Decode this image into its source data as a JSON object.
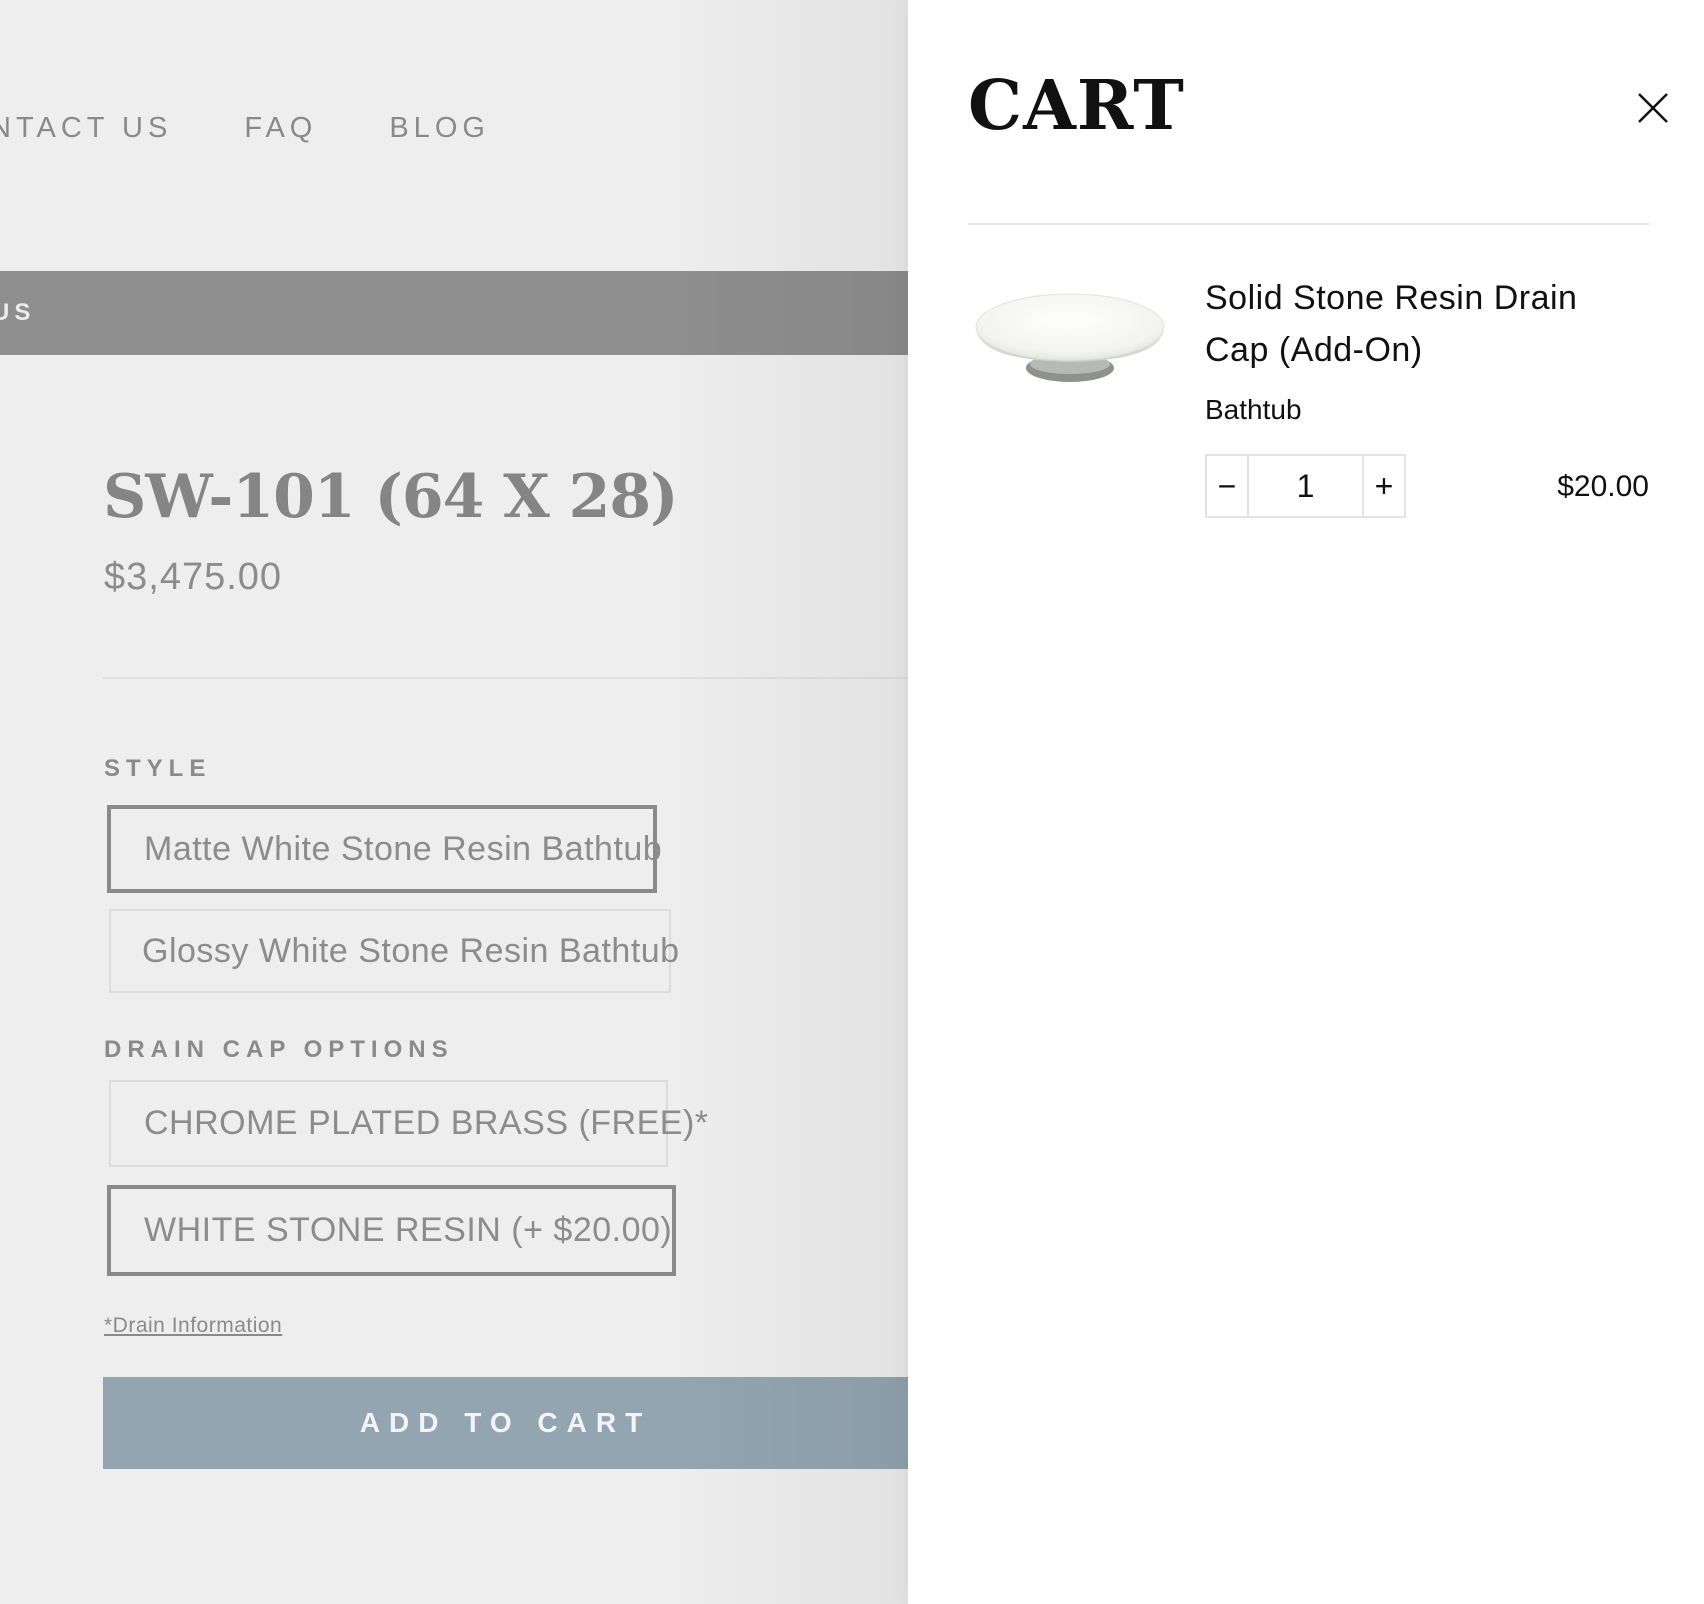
{
  "nav": {
    "items": [
      "NTACT US",
      "FAQ",
      "BLOG"
    ]
  },
  "announcement": {
    "text": "US"
  },
  "product": {
    "title": "SW-101 (64 X 28)",
    "price": "$3,475.00",
    "style_label": "STYLE",
    "style_options": [
      {
        "label": "Matte White Stone Resin Bathtub",
        "selected": true
      },
      {
        "label": "Glossy White Stone Resin Bathtub",
        "selected": false
      }
    ],
    "drain_label": "DRAIN CAP OPTIONS",
    "drain_options": [
      {
        "label": "CHROME PLATED BRASS (FREE)*",
        "selected": false
      },
      {
        "label": "WHITE STONE RESIN (+ $20.00)",
        "selected": true
      }
    ],
    "drain_info_link": "*Drain Information",
    "add_to_cart_label": "ADD TO CART"
  },
  "cart": {
    "title": "CART",
    "close_icon": "close-icon",
    "items": [
      {
        "name": "Solid Stone Resin Drain Cap (Add-On)",
        "variant": "Bathtub",
        "quantity": "1",
        "minus_label": "−",
        "plus_label": "+",
        "price": "$20.00"
      }
    ]
  },
  "colors": {
    "add_to_cart_bg": "#93a5b1",
    "announce_bg": "#8e8e8e",
    "page_bg": "#eeeeee"
  }
}
